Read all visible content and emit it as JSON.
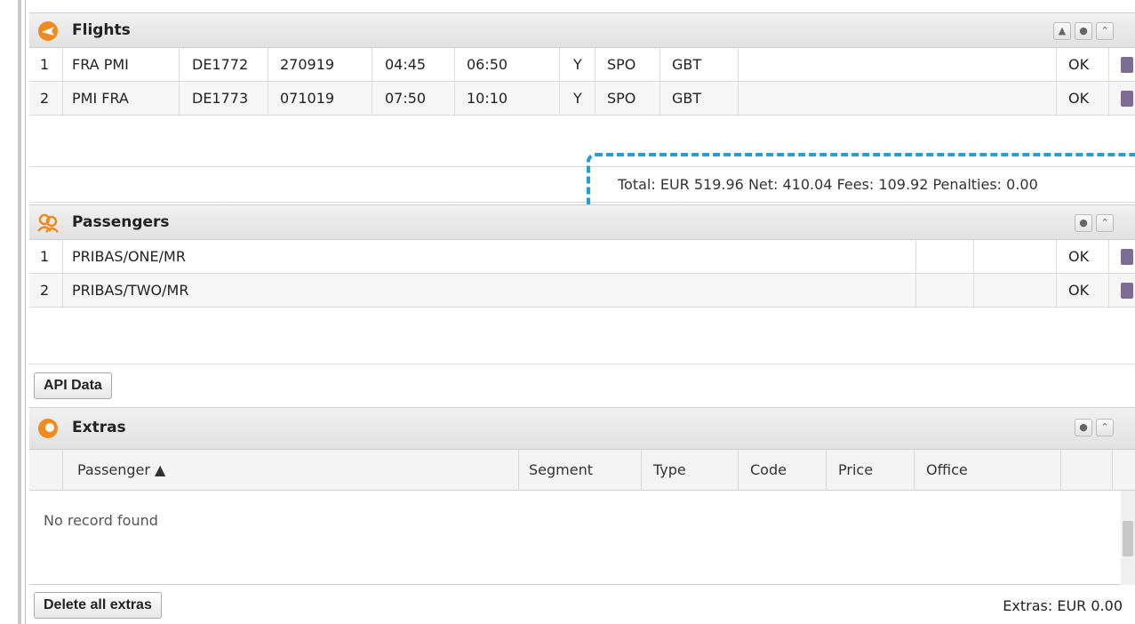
{
  "flights": {
    "title": "Flights",
    "rows": [
      {
        "idx": "1",
        "route": "FRA PMI",
        "flight": "DE1772",
        "date": "270919",
        "dep": "04:45",
        "arr": "06:50",
        "cls": "Y",
        "type": "SPO",
        "code": "GBT",
        "status": "OK"
      },
      {
        "idx": "2",
        "route": "PMI FRA",
        "flight": "DE1773",
        "date": "071019",
        "dep": "07:50",
        "arr": "10:10",
        "cls": "Y",
        "type": "SPO",
        "code": "GBT",
        "status": "OK"
      }
    ],
    "total": "Total: EUR 519.96 Net: 410.04 Fees: 109.92 Penalties: 0.00"
  },
  "passengers": {
    "title": "Passengers",
    "rows": [
      {
        "idx": "1",
        "name": "PRIBAS/ONE/MR",
        "status": "OK"
      },
      {
        "idx": "2",
        "name": "PRIBAS/TWO/MR",
        "status": "OK"
      }
    ],
    "api_button": "API Data"
  },
  "extras": {
    "title": "Extras",
    "columns": [
      "Passenger ▲",
      "Segment",
      "Type",
      "Code",
      "Price",
      "Office"
    ],
    "empty_text": "No record found",
    "delete_button": "Delete all extras",
    "total": "Extras:  EUR 0.00"
  },
  "icons": {
    "flights": "plane-icon",
    "passengers": "people-icon",
    "extras": "extras-icon",
    "collapse": "collapse-icon",
    "settings": "gear-icon",
    "up": "double-up-icon",
    "delete": "trash-icon"
  },
  "colors": {
    "accent": "#f08a1c",
    "highlight": "#1ea0db",
    "trash": "#7c6b93"
  }
}
